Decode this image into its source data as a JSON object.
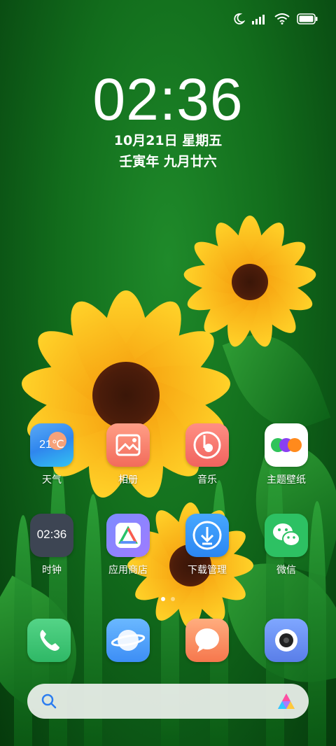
{
  "status_bar": {
    "icons": [
      "moon-icon",
      "signal-icon",
      "wifi-icon",
      "battery-icon"
    ]
  },
  "lockscreen": {
    "time": "02:36",
    "date": "10月21日 星期五",
    "lunar_date": "壬寅年 九月廿六"
  },
  "apps": {
    "row1": [
      {
        "label": "天气",
        "icon": "weather-icon",
        "temp": "21℃"
      },
      {
        "label": "相册",
        "icon": "gallery-icon"
      },
      {
        "label": "音乐",
        "icon": "music-icon"
      },
      {
        "label": "主题壁纸",
        "icon": "themes-icon"
      }
    ],
    "row2": [
      {
        "label": "时钟",
        "icon": "clock-icon",
        "time": "02:36"
      },
      {
        "label": "应用商店",
        "icon": "app-store-icon"
      },
      {
        "label": "下载管理",
        "icon": "download-icon"
      },
      {
        "label": "微信",
        "icon": "wechat-icon"
      }
    ]
  },
  "page_indicator": {
    "pages": 2,
    "current": 1
  },
  "dock": [
    "phone-icon",
    "browser-icon",
    "messages-icon",
    "camera-icon"
  ],
  "search_bar": {
    "icon": "search-icon",
    "assistant_icon": "ai-assistant-icon"
  }
}
